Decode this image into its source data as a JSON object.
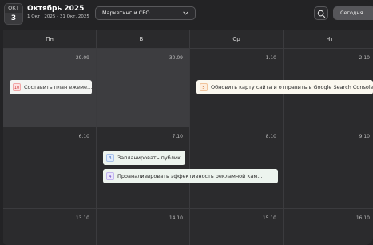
{
  "header": {
    "date_badge": {
      "month": "ОКТ",
      "day": "3"
    },
    "title": "Октябрь 2025",
    "range": "1 Окт . 2025 - 31 Окт. 2025",
    "project_select": "Маркетинг и СЕО",
    "today_button": "Сегодня"
  },
  "weekdays": [
    "Пн",
    "Вт",
    "Ср",
    "Чт"
  ],
  "weeks": [
    [
      "29.09",
      "30.09",
      "1.10",
      "2.10"
    ],
    [
      "6.10",
      "7.10",
      "8.10",
      "9.10"
    ],
    [
      "13.10",
      "14.10",
      "15.10",
      "16.10"
    ]
  ],
  "events": {
    "e1": {
      "icon_text": "10",
      "icon_color": "red",
      "title": "Составить план ежеме..."
    },
    "e2": {
      "icon_text": "5",
      "icon_color": "orange",
      "title": "Обновить карту сайта и отправить в Google Search Console"
    },
    "e3": {
      "icon_text": "3",
      "icon_color": "blue",
      "title": "Запланировать публик..."
    },
    "e4": {
      "icon_text": "4",
      "icon_color": "purple",
      "title": "Проанализировать эффективность рекламной кам..."
    }
  },
  "icons": {
    "select_chevron": "chevron-down-icon",
    "search": "search-icon"
  },
  "colors": {
    "background": "#232325",
    "past_day": "#3d3d40",
    "current_day": "#2b2b2d",
    "today_button": "#56565a"
  }
}
